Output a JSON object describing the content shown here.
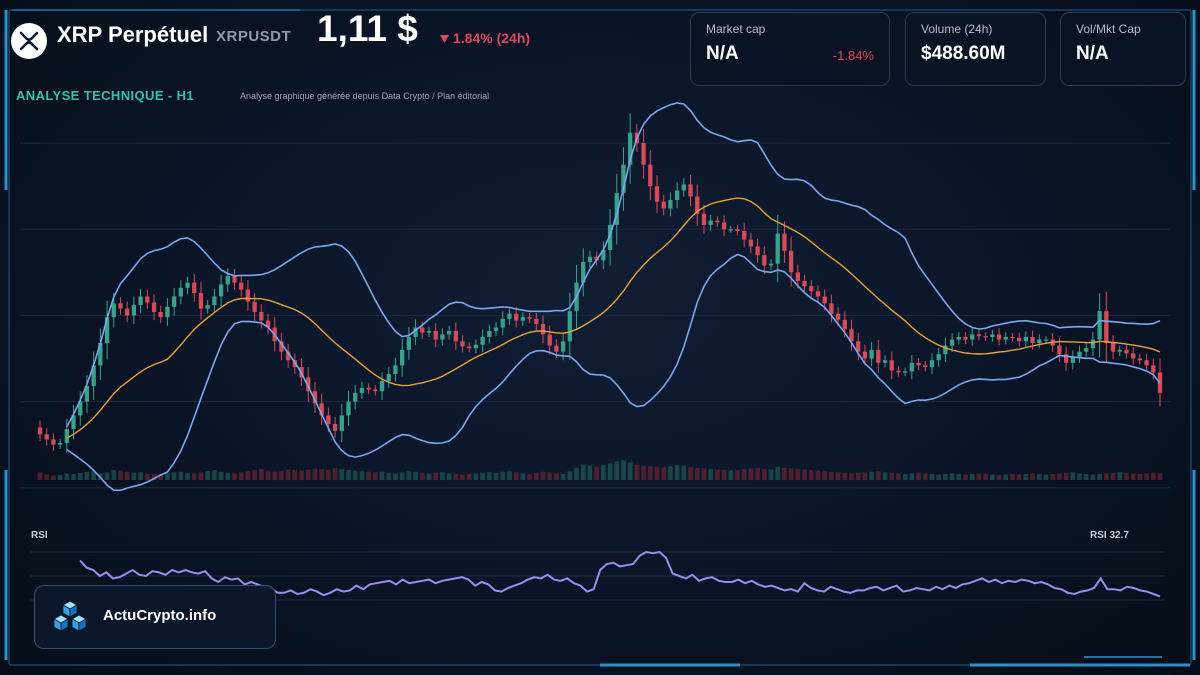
{
  "header": {
    "logo_icon": "xrp-logo-icon",
    "title": "XRP Perpétuel",
    "symbol": "XRPUSDT",
    "price": "1,11 $",
    "change_arrow_icon": "triangle-down-icon",
    "change": "1.84% (24h)"
  },
  "stats": {
    "market_cap": {
      "label": "Market cap",
      "value": "N/A",
      "change": "-1.84%"
    },
    "volume": {
      "label": "Volume (24h)",
      "value": "$488.60M"
    },
    "ratio": {
      "label": "Vol/Mkt Cap",
      "value": "N/A"
    }
  },
  "analysis": {
    "label": "ANALYSE TECHNIQUE - H1",
    "note": "Analyse graphique générée depuis Data Crypto / Plan éditorial"
  },
  "rsi": {
    "label": "RSI",
    "value_label": "RSI 32.7"
  },
  "brand": {
    "icon": "cubes-icon",
    "name": "ActuCrypto.info"
  },
  "colors": {
    "up": "#3aa28a",
    "down": "#d64b5a",
    "ma": "#e7a23a",
    "bollinger": "#7aa8ee",
    "rsi": "#9b8cf0",
    "accent": "#2ec6a4",
    "negative": "#e0475a",
    "frame": "#2e8fc8"
  },
  "chart_data": [
    {
      "type": "candlestick",
      "interval": "H1",
      "indicators": [
        "bollinger_bands",
        "moving_average",
        "volume"
      ],
      "price_range": [
        0.98,
        1.45
      ],
      "close": [
        1.062,
        1.056,
        1.05,
        1.052,
        1.068,
        1.084,
        1.1,
        1.118,
        1.142,
        1.168,
        1.198,
        1.214,
        1.208,
        1.2,
        1.212,
        1.222,
        1.215,
        1.204,
        1.198,
        1.21,
        1.222,
        1.232,
        1.238,
        1.226,
        1.208,
        1.212,
        1.222,
        1.236,
        1.246,
        1.238,
        1.23,
        1.216,
        1.204,
        1.194,
        1.186,
        1.17,
        1.158,
        1.148,
        1.14,
        1.128,
        1.112,
        1.098,
        1.084,
        1.074,
        1.066,
        1.084,
        1.1,
        1.11,
        1.116,
        1.114,
        1.112,
        1.124,
        1.132,
        1.142,
        1.16,
        1.175,
        1.186,
        1.18,
        1.182,
        1.172,
        1.178,
        1.182,
        1.17,
        1.164,
        1.162,
        1.166,
        1.175,
        1.182,
        1.186,
        1.196,
        1.202,
        1.194,
        1.198,
        1.196,
        1.19,
        1.178,
        1.165,
        1.158,
        1.17,
        1.205,
        1.238,
        1.262,
        1.268,
        1.264,
        1.276,
        1.305,
        1.342,
        1.375,
        1.412,
        1.4,
        1.375,
        1.35,
        1.332,
        1.324,
        1.334,
        1.345,
        1.352,
        1.338,
        1.318,
        1.305,
        1.31,
        1.308,
        1.3,
        1.3,
        1.298,
        1.288,
        1.28,
        1.27,
        1.258,
        1.26,
        1.295,
        1.275,
        1.25,
        1.24,
        1.234,
        1.228,
        1.222,
        1.214,
        1.202,
        1.195,
        1.184,
        1.17,
        1.158,
        1.15,
        1.16,
        1.145,
        1.148,
        1.136,
        1.134,
        1.135,
        1.145,
        1.142,
        1.14,
        1.148,
        1.155,
        1.165,
        1.172,
        1.175,
        1.172,
        1.178,
        1.176,
        1.175,
        1.178,
        1.172,
        1.175,
        1.174,
        1.17,
        1.175,
        1.168,
        1.172,
        1.172,
        1.165,
        1.155,
        1.145,
        1.152,
        1.158,
        1.162,
        1.172,
        1.205,
        1.168,
        1.158,
        1.16,
        1.156,
        1.15,
        1.148,
        1.142,
        1.134,
        1.11
      ],
      "volume_range": [
        0,
        100
      ],
      "volume": [
        14,
        10,
        8,
        9,
        12,
        11,
        13,
        15,
        16,
        12,
        14,
        18,
        17,
        15,
        13,
        14,
        12,
        11,
        12,
        13,
        14,
        15,
        13,
        12,
        14,
        16,
        18,
        15,
        13,
        12,
        14,
        16,
        18,
        20,
        17,
        15,
        16,
        19,
        18,
        17,
        19,
        21,
        20,
        18,
        22,
        20,
        18,
        17,
        16,
        15,
        14,
        15,
        13,
        12,
        14,
        16,
        15,
        13,
        12,
        13,
        14,
        12,
        11,
        10,
        11,
        12,
        13,
        14,
        13,
        15,
        16,
        14,
        12,
        11,
        13,
        15,
        14,
        12,
        11,
        16,
        22,
        28,
        26,
        24,
        27,
        30,
        34,
        36,
        32,
        28,
        26,
        25,
        24,
        23,
        25,
        27,
        26,
        24,
        22,
        21,
        20,
        19,
        18,
        17,
        18,
        20,
        21,
        22,
        20,
        19,
        24,
        22,
        21,
        20,
        19,
        18,
        17,
        16,
        15,
        14,
        13,
        12,
        13,
        14,
        15,
        16,
        14,
        13,
        12,
        11,
        12,
        13,
        12,
        11,
        10,
        11,
        12,
        11,
        10,
        11,
        12,
        11,
        10,
        9,
        10,
        11,
        10,
        11,
        12,
        11,
        10,
        11,
        12,
        13,
        14,
        12,
        11,
        10,
        11,
        12,
        13,
        14,
        13,
        12,
        11,
        12,
        13,
        12
      ],
      "rsi_range": [
        0,
        100
      ],
      "rsi": [
        63,
        57,
        55,
        50,
        53,
        48,
        49,
        52,
        55,
        51,
        50,
        54,
        53,
        51,
        55,
        53,
        55,
        53,
        52,
        54,
        48,
        45,
        49,
        47,
        48,
        43,
        45,
        43,
        41,
        40,
        36,
        36,
        38,
        35,
        36,
        39,
        37,
        34,
        36,
        39,
        37,
        38,
        42,
        39,
        43,
        44,
        45,
        46,
        43,
        47,
        44,
        45,
        46,
        47,
        44,
        46,
        47,
        48,
        49,
        47,
        42,
        45,
        43,
        38,
        37,
        40,
        42,
        44,
        47,
        49,
        48,
        51,
        47,
        46,
        48,
        44,
        42,
        37,
        39,
        55,
        60,
        61,
        58,
        59,
        60,
        67,
        70,
        69,
        70,
        65,
        52,
        50,
        48,
        51,
        46,
        48,
        49,
        46,
        45,
        45,
        47,
        44,
        46,
        43,
        41,
        42,
        40,
        38,
        39,
        37,
        44,
        40,
        38,
        37,
        41,
        39,
        37,
        36,
        38,
        38,
        40,
        41,
        38,
        40,
        42,
        37,
        38,
        40,
        39,
        38,
        41,
        39,
        42,
        40,
        43,
        44,
        46,
        48,
        45,
        47,
        44,
        46,
        45,
        47,
        46,
        44,
        45,
        43,
        40,
        39,
        36,
        35,
        37,
        38,
        40,
        48,
        39,
        39,
        38,
        41,
        40,
        38,
        37,
        35,
        33
      ],
      "rsi_ylim": [
        20,
        80
      ]
    }
  ]
}
